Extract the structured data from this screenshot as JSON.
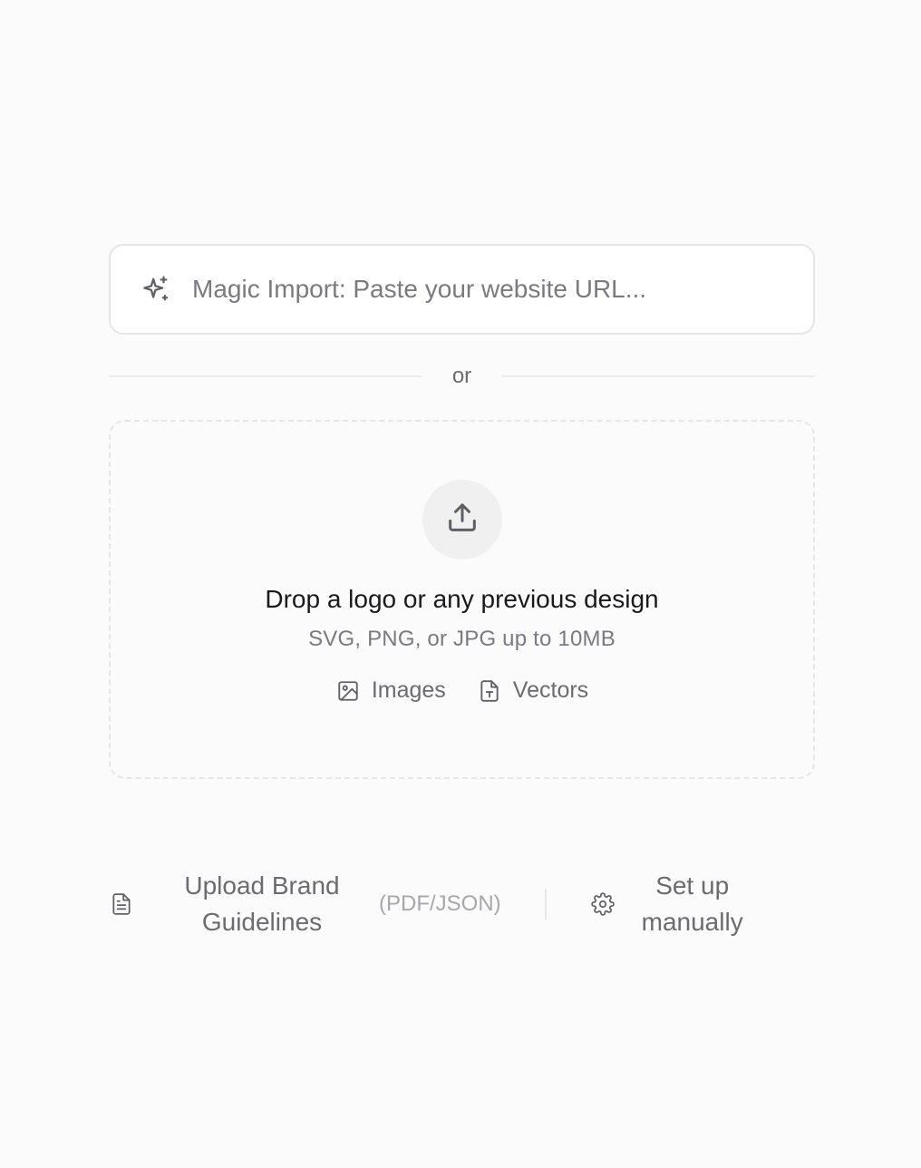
{
  "magic_import": {
    "icon": "sparkles-icon",
    "placeholder": "Magic Import: Paste your website URL..."
  },
  "divider": {
    "label": "or"
  },
  "dropzone": {
    "icon": "upload-icon",
    "title": "Drop a logo or any previous design",
    "subtitle": "SVG, PNG, or JPG up to 10MB",
    "types": [
      {
        "icon": "image-icon",
        "label": "Images"
      },
      {
        "icon": "file-text-icon",
        "label": "Vectors"
      }
    ]
  },
  "footer": {
    "guidelines": {
      "icon": "document-icon",
      "label": "Upload Brand Guidelines",
      "format": "(PDF/JSON)"
    },
    "manual": {
      "icon": "gear-icon",
      "label": "Set up manually"
    }
  }
}
